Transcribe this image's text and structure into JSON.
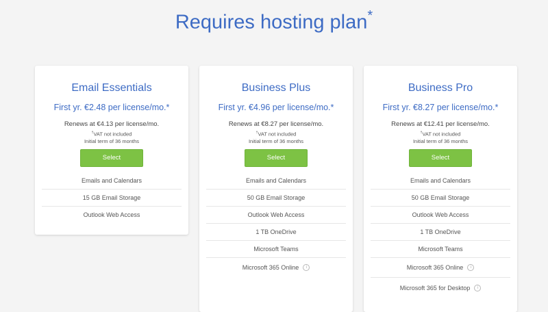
{
  "page": {
    "title": "Requires hosting plan",
    "title_mark": "*"
  },
  "colors": {
    "accent": "#3d6bc4",
    "button": "#7dc244",
    "background": "#f4f4f4"
  },
  "plans": [
    {
      "name": "Email Essentials",
      "price": "First yr. €2.48 per license/mo.*",
      "renews": "Renews at €4.13 per license/mo.",
      "vat_mark": "†",
      "vat": "VAT not included",
      "term": "Initial term of 36 months",
      "select_label": "Select",
      "features": [
        "Emails and Calendars",
        "15 GB Email Storage",
        "Outlook Web Access"
      ]
    },
    {
      "name": "Business Plus",
      "price": "First yr. €4.96 per license/mo.*",
      "renews": "Renews at €8.27 per license/mo.",
      "vat_mark": "†",
      "vat": "VAT not included",
      "term": "Initial term of 36 months",
      "select_label": "Select",
      "features": [
        "Emails and Calendars",
        "50 GB Email Storage",
        "Outlook Web Access",
        "1 TB OneDrive",
        "Microsoft Teams",
        "Microsoft 365 Online"
      ]
    },
    {
      "name": "Business Pro",
      "price": "First yr. €8.27 per license/mo.*",
      "renews": "Renews at €12.41 per license/mo.",
      "vat_mark": "†",
      "vat": "VAT not included",
      "term": "Initial term of 36 months",
      "select_label": "Select",
      "features": [
        "Emails and Calendars",
        "50 GB Email Storage",
        "Outlook Web Access",
        "1 TB OneDrive",
        "Microsoft Teams",
        "Microsoft 365 Online",
        "Microsoft 365 for Desktop"
      ]
    }
  ],
  "info_icon": {
    "name": "info-icon",
    "glyph": "i"
  }
}
